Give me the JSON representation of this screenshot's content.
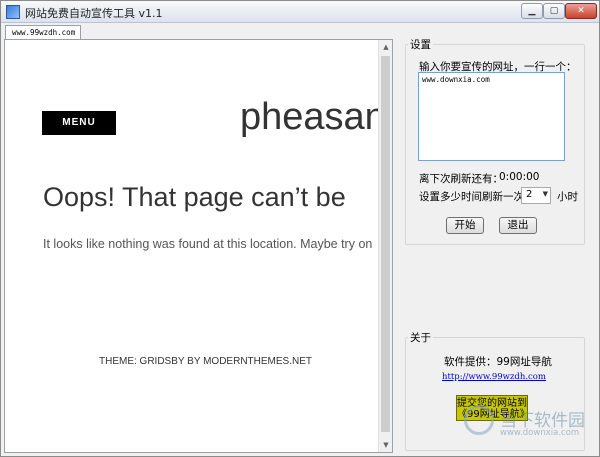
{
  "window": {
    "title": "网站免费自动宣传工具 v1.1",
    "controls": {
      "minimize": "▁",
      "maximize": "▢",
      "close": "✕"
    }
  },
  "tabs": [
    {
      "label": "www.99wzdh.com"
    }
  ],
  "browser": {
    "menu_label": "MENU",
    "site_title": "pheasan",
    "heading": "Oops! That page can’t be",
    "paragraph": "It looks like nothing was found at this location. Maybe try on",
    "footer_theme": "THEME: GRIDSBY BY MODERNTHEMES.NET"
  },
  "settings": {
    "group_title": "设置",
    "url_prompt": "输入你要宣传的网址，一行一个：",
    "url_text": "www.downxia.com",
    "next_refresh_label": "离下次刷新还有：",
    "next_refresh_value": "0:00:00",
    "interval_label": "设置多少时间刷新一次：",
    "interval_value": "2",
    "interval_unit": "小时",
    "start_label": "开始",
    "exit_label": "退出"
  },
  "about": {
    "group_title": "关于",
    "provider": "软件提供：99网址导航",
    "link": "http://www.99wzdh.com",
    "submit_line1": "提交您的网站到",
    "submit_line2": "《99网址导航》"
  },
  "watermark": {
    "name": "当下软件园",
    "url": "www.downxia.com"
  }
}
